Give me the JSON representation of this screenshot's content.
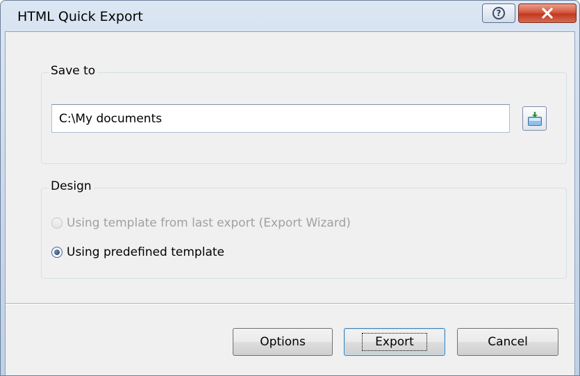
{
  "window": {
    "title": "HTML Quick Export"
  },
  "save_to": {
    "label": "Save to",
    "path_value": "C:\\My documents",
    "browse_icon": "folder-browse-icon"
  },
  "design": {
    "label": "Design",
    "options": [
      {
        "label": "Using template from last export (Export Wizard)",
        "selected": false,
        "enabled": false
      },
      {
        "label": "Using predefined template",
        "selected": true,
        "enabled": true
      }
    ]
  },
  "buttons": {
    "options": "Options",
    "export": "Export",
    "cancel": "Cancel"
  },
  "colors": {
    "close_button": "#c0391f",
    "title_gradient_top": "#dbe6f3",
    "client_bg": "#f0f0f0"
  }
}
